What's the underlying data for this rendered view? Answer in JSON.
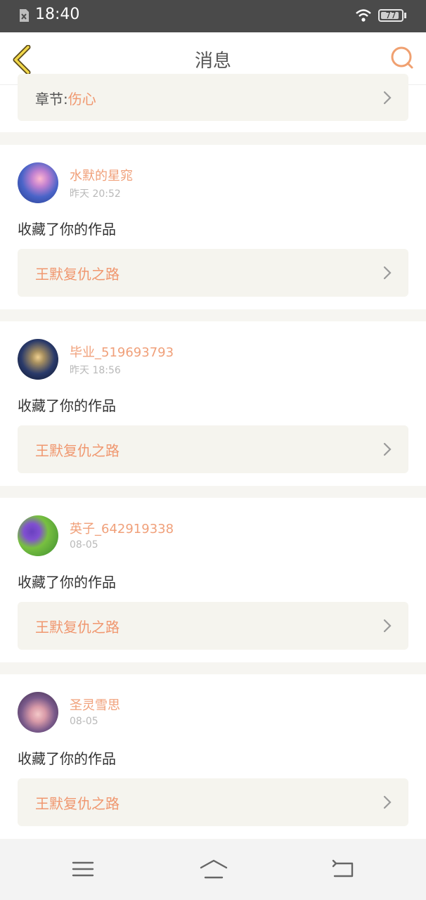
{
  "status_bar": {
    "time": "18:40",
    "battery": "77"
  },
  "header": {
    "title": "消息"
  },
  "top_card": {
    "chapter_prefix": "章节:",
    "chapter_name": "伤心"
  },
  "messages": [
    {
      "user": "水默的星窕",
      "time": "昨天 20:52",
      "action": "收藏了你的作品",
      "work": "王默复仇之路"
    },
    {
      "user": "毕业_519693793",
      "time": "昨天 18:56",
      "action": "收藏了你的作品",
      "work": "王默复仇之路"
    },
    {
      "user": "英子_642919338",
      "time": "08-05",
      "action": "收藏了你的作品",
      "work": "王默复仇之路"
    },
    {
      "user": "圣灵雪思",
      "time": "08-05",
      "action": "收藏了你的作品",
      "work": "王默复仇之路"
    }
  ],
  "colors": {
    "accent": "#f0976f",
    "status_bar": "#4a4a4a",
    "card_background": "#ffffff",
    "link_background": "#f5f4ee"
  }
}
